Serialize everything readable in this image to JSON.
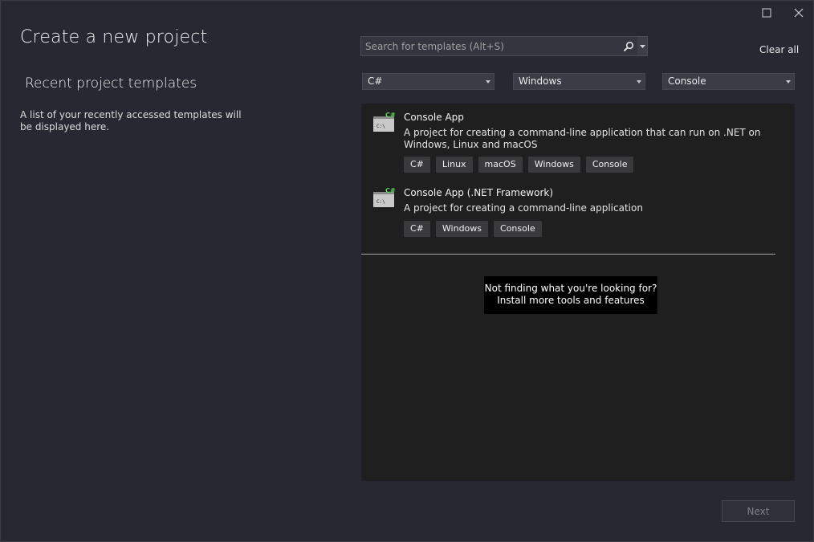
{
  "window": {
    "maximize_icon": "maximize-icon",
    "close_icon": "close-icon"
  },
  "header": {
    "title": "Create a new project"
  },
  "recent": {
    "title": "Recent project templates",
    "description": "A list of your recently accessed templates will be displayed here."
  },
  "search": {
    "placeholder": "Search for templates (Alt+S)",
    "value": "",
    "icon": "search-icon"
  },
  "clear_all": "Clear all",
  "filters": {
    "language": "C#",
    "platform": "Windows",
    "project_type": "Console"
  },
  "templates": [
    {
      "name": "Console App",
      "description": "A project for creating a command-line application that can run on .NET on Windows, Linux and macOS",
      "icon_badge": "C#",
      "icon_text": "C:\\",
      "tags": [
        "C#",
        "Linux",
        "macOS",
        "Windows",
        "Console"
      ]
    },
    {
      "name": "Console App (.NET Framework)",
      "description": "A project for creating a command-line application",
      "icon_badge": "C#",
      "icon_text": "C:\\",
      "tags": [
        "C#",
        "Windows",
        "Console"
      ]
    }
  ],
  "not_finding": {
    "question": "Not finding what you're looking for?",
    "link": "Install more tools and features"
  },
  "footer": {
    "next_label": "Next"
  },
  "colors": {
    "background": "#262931",
    "results_panel": "#1f1f20",
    "tag_bg": "#3a3a3d",
    "badge_green": "#5fd35f"
  }
}
